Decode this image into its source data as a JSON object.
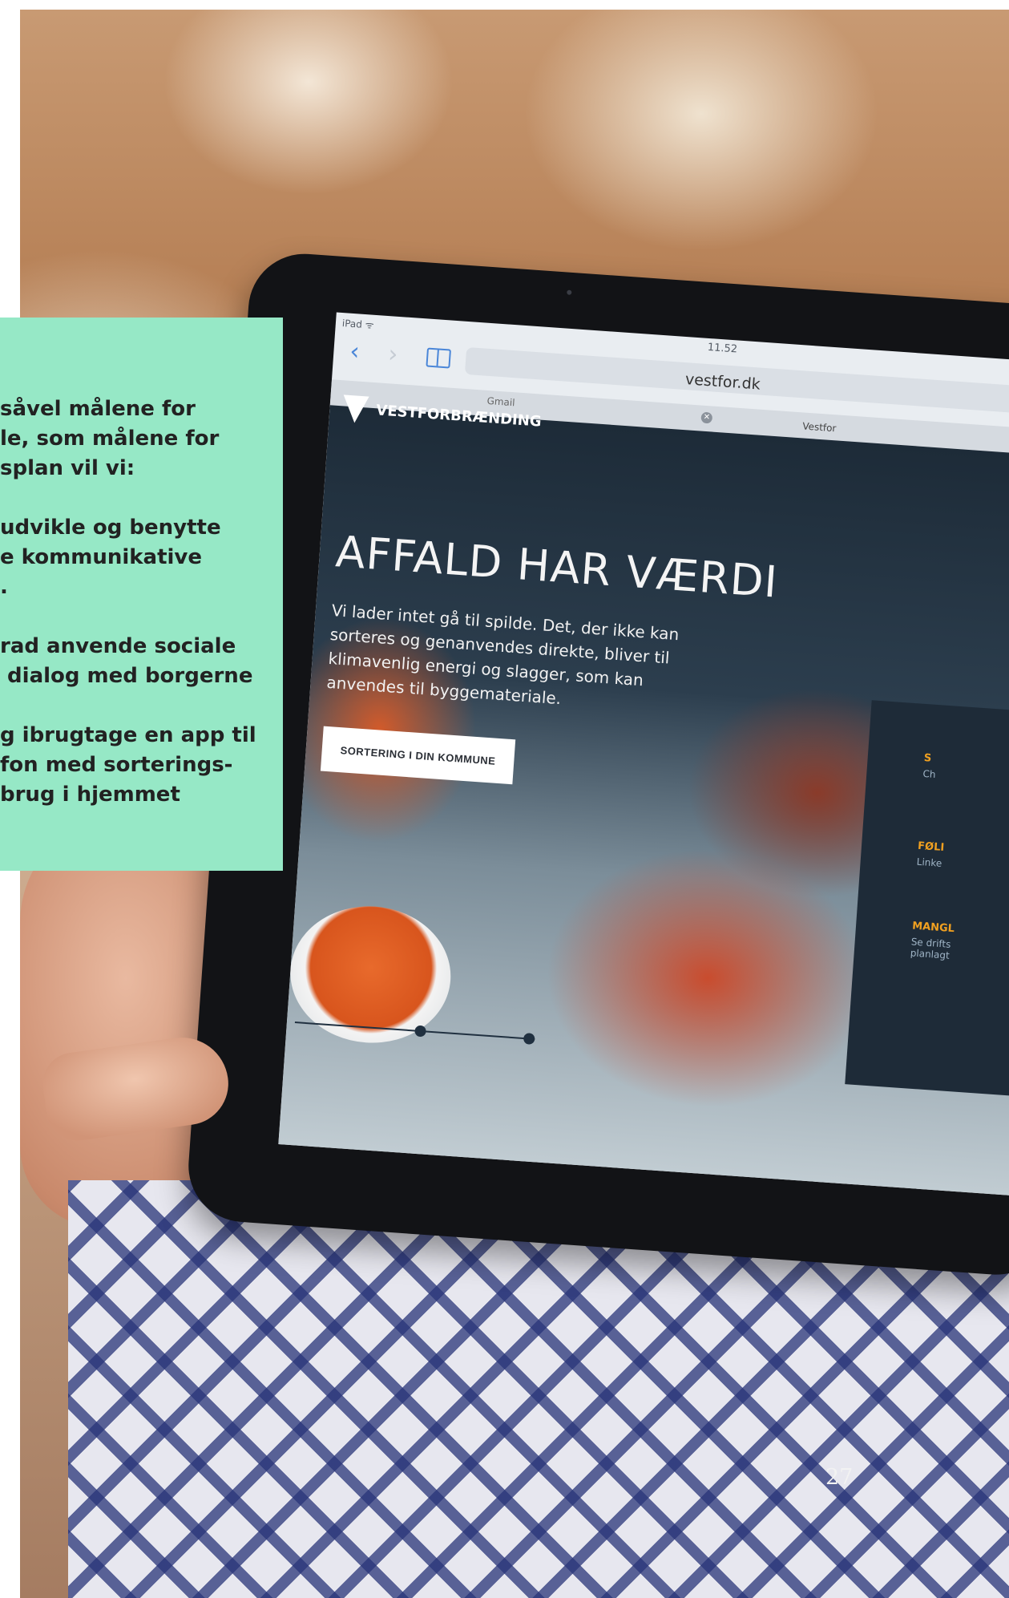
{
  "panel": {
    "intro_lines": [
      "såvel målene for",
      "le, som målene for",
      "splan vil vi:"
    ],
    "bullet1_lines": [
      "udvikle og benytte",
      "e kommunikative",
      "."
    ],
    "bullet2_lines": [
      "rad anvende sociale",
      " dialog med borgerne"
    ],
    "bullet3_lines": [
      "g ibrugtage en app til",
      "fon med sorterings-",
      "brug i hjemmet"
    ]
  },
  "tablet": {
    "status_left": "iPad ᯤ",
    "time": "11.52",
    "url": "vestfor.dk",
    "tab_gmail": "Gmail",
    "tab_close": "✕",
    "tab_vestfor": "Vestfor",
    "site": {
      "logo": "VESTFORBRÆNDING",
      "hero_title": "AFFALD HAR VÆRDI",
      "hero_text": "Vi lader intet gå til spilde. Det, der ikke kan sorteres og genanvendes direkte, bliver til klimavenlig energi og slagger, som kan anvendes til byggemateriale.",
      "cta": "SORTERING I DIN KOMMUNE",
      "side_items": [
        {
          "label": "S",
          "sub": "Ch"
        },
        {
          "label": "FØLI",
          "sub": "Linke"
        },
        {
          "label": "MANGL",
          "sub": "Se drifts planlagt"
        }
      ]
    }
  },
  "page_number": "27"
}
